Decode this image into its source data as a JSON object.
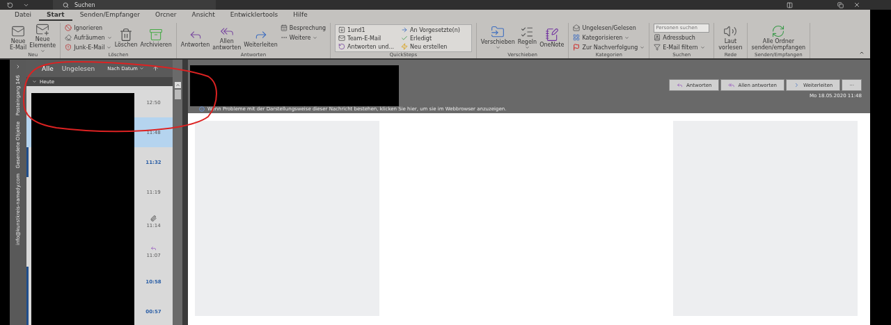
{
  "title_bar": {
    "search": {
      "placeholder": "Suchen"
    }
  },
  "menu_tabs": [
    {
      "label": "Datei",
      "selected": false
    },
    {
      "label": "Start",
      "selected": true
    },
    {
      "label": "Senden/Empfanger",
      "selected": false
    },
    {
      "label": "Orcner",
      "selected": false
    },
    {
      "label": "Ansicht",
      "selected": false
    },
    {
      "label": "Entwicklertools",
      "selected": false
    },
    {
      "label": "Hilfe",
      "selected": false
    }
  ],
  "ribbon": {
    "groups": [
      {
        "label": "Neu",
        "kind": "plain",
        "items": [
          {
            "kind": "large",
            "label": "Neue\nE-Mail",
            "dropdown": false
          },
          {
            "kind": "large",
            "label": "Neue\nElemente",
            "dropdown": true
          }
        ]
      },
      {
        "label": "Löschen",
        "kind": "plain",
        "items": [
          {
            "kind": "small",
            "label": "Ignorieren",
            "dropdown": false
          },
          {
            "kind": "small",
            "label": "Aufräumen",
            "dropdown": true
          },
          {
            "kind": "small",
            "label": "Junk-E-Mail",
            "dropdown": true
          },
          {
            "kind": "large",
            "label": "Löschen",
            "dropdown": false
          },
          {
            "kind": "large",
            "label": "Archivieren",
            "dropdown": false
          }
        ]
      },
      {
        "label": "Antworten",
        "kind": "plain",
        "items": [
          {
            "kind": "large",
            "label": "Antworten",
            "dropdown": false
          },
          {
            "kind": "large",
            "label": "Allen\nantworten",
            "dropdown": false
          },
          {
            "kind": "large",
            "label": "Weiterleiten",
            "dropdown": false
          },
          {
            "kind": "small",
            "label": "Besprechung",
            "dropdown": false
          },
          {
            "kind": "small",
            "label": "Weitere",
            "dropdown": true
          }
        ]
      },
      {
        "label": "QuickSteps",
        "kind": "gallery",
        "items": [
          {
            "kind": "small",
            "label": "1und1",
            "dropdown": false
          },
          {
            "kind": "small",
            "label": "Team-E-Mail",
            "dropdown": false
          },
          {
            "kind": "small",
            "label": "Antworten und...",
            "dropdown": false
          },
          {
            "kind": "small",
            "label": "An Vorgesetzte(n)",
            "dropdown": false
          },
          {
            "kind": "small",
            "label": "Erledigt",
            "dropdown": false
          },
          {
            "kind": "small",
            "label": "Neu erstellen",
            "dropdown": false
          }
        ]
      },
      {
        "label": "Verschieben",
        "kind": "plain",
        "items": [
          {
            "kind": "large",
            "label": "Verschieben",
            "dropdown": true
          },
          {
            "kind": "large",
            "label": "Regeln",
            "dropdown": true
          },
          {
            "kind": "large",
            "label": "OneNote",
            "dropdown": false
          }
        ]
      },
      {
        "label": "Kategorien",
        "kind": "plain",
        "items": [
          {
            "kind": "small",
            "label": "Ungelesen/Gelesen",
            "dropdown": false
          },
          {
            "kind": "small",
            "label": "Kategorisieren",
            "dropdown": true
          },
          {
            "kind": "small",
            "label": "Zur Nachverfolgung",
            "dropdown": true
          }
        ]
      },
      {
        "label": "Suchen",
        "kind": "plain",
        "items": [
          {
            "kind": "search",
            "placeholder": "Personen suchen"
          },
          {
            "kind": "small",
            "label": "Adressbuch",
            "dropdown": false
          },
          {
            "kind": "small",
            "label": "E-Mail filtern",
            "dropdown": true
          }
        ]
      },
      {
        "label": "Rede",
        "kind": "plain",
        "items": [
          {
            "kind": "large",
            "label": "Laut\nvorlesen",
            "dropdown": false
          }
        ]
      },
      {
        "label": "Senden/Empfangen",
        "kind": "plain",
        "items": [
          {
            "kind": "large",
            "label": "Alle Ordner\nsenden/empfangen",
            "dropdown": false
          }
        ]
      }
    ]
  },
  "nav_pane": {
    "folders": [
      "info@kunstkreis-namedy.com",
      "Gesendete Objekte",
      "Posteingang 146"
    ]
  },
  "mail_list": {
    "filters": [
      {
        "label": "Alle",
        "selected": true
      },
      {
        "label": "Ungelesen",
        "selected": false
      }
    ],
    "sort": "Nach Datum",
    "group": "Heute",
    "rows": [
      {
        "time": "12:50",
        "selected": false,
        "unread": false,
        "attachment": false,
        "replied": false
      },
      {
        "time": "11:48",
        "selected": true,
        "unread": false,
        "attachment": false,
        "replied": false
      },
      {
        "time": "11:32",
        "selected": false,
        "unread": true,
        "attachment": false,
        "replied": false
      },
      {
        "time": "11:19",
        "selected": false,
        "unread": false,
        "attachment": false,
        "replied": false
      },
      {
        "time": "11:14",
        "selected": false,
        "unread": false,
        "attachment": true,
        "replied": false
      },
      {
        "time": "11:07",
        "selected": false,
        "unread": false,
        "attachment": false,
        "replied": true
      },
      {
        "time": "10:58",
        "selected": false,
        "unread": true,
        "attachment": false,
        "replied": false
      },
      {
        "time": "00:57",
        "selected": false,
        "unread": true,
        "attachment": false,
        "replied": false
      }
    ]
  },
  "reading_pane": {
    "actions": [
      {
        "kind": "reply",
        "label": "Antworten"
      },
      {
        "kind": "reply_all",
        "label": "Allen antworten"
      },
      {
        "kind": "forward",
        "label": "Weiterleiten"
      },
      {
        "kind": "more",
        "label": "···"
      }
    ],
    "date": "Mo 18.05.2020 11:48",
    "info": "Wenn Probleme mit der Darstellungsweise dieser Nachricht bestehen, klicken Sie hier, um sie im Webbrowser anzuzeigen."
  }
}
